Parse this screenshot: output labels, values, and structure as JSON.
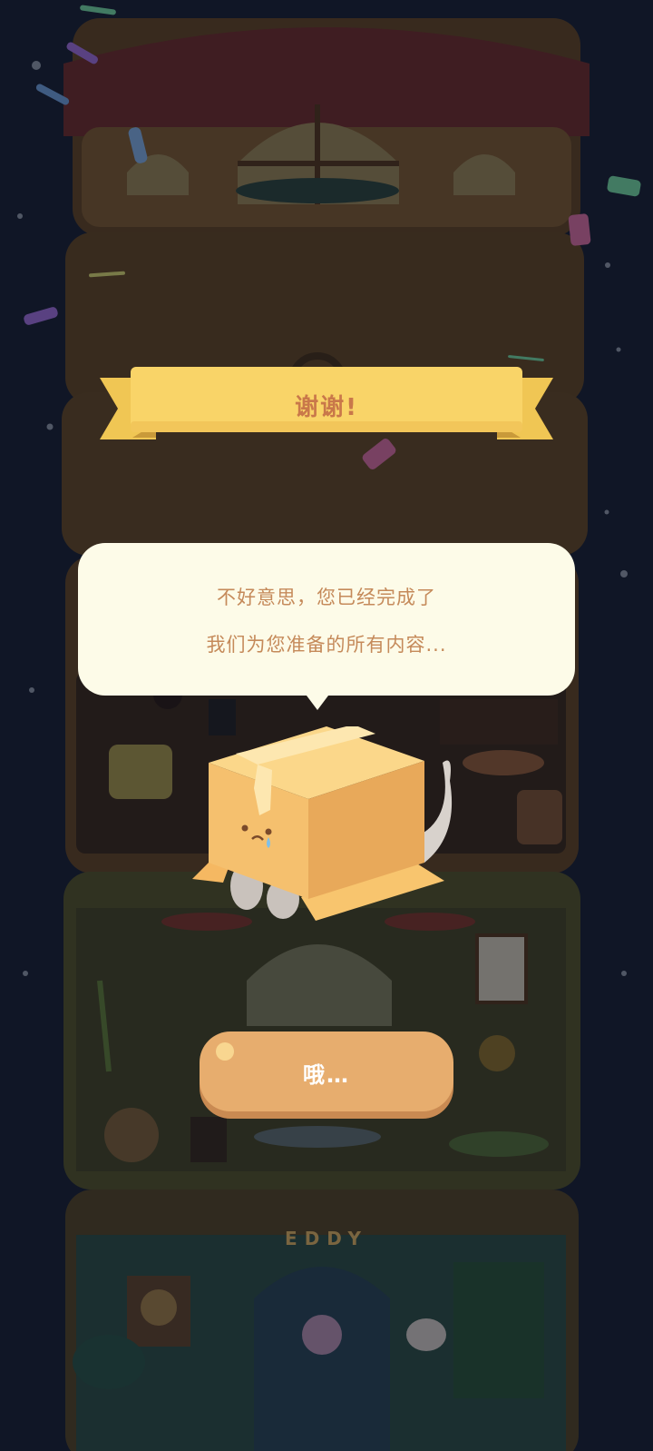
{
  "dialog": {
    "title": "谢谢!",
    "message_line1": "不好意思，您已经完成了",
    "message_line2": "我们为您准备的所有内容...",
    "button_label": "哦…"
  },
  "background": {
    "brand_text": "EDDY"
  },
  "colors": {
    "ribbon": "#f9d468",
    "ribbon_title": "#c9784a",
    "bubble": "#fdfbe8",
    "bubble_text": "#c58a5a",
    "button": "#e7ad6e",
    "button_shadow": "#c98a52",
    "box": "#f5c46f",
    "night_sky": "#141c2c"
  }
}
